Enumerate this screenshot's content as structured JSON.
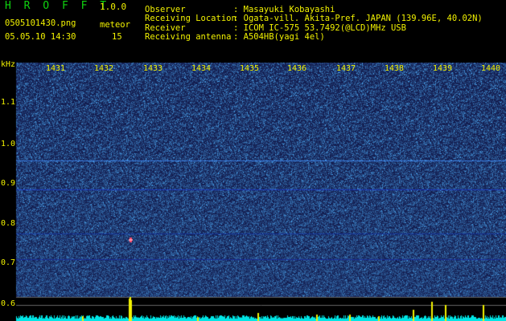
{
  "app": {
    "name": "H R O F F T",
    "version": "1.0.0"
  },
  "file": {
    "name": "0505101430.png",
    "datetime": "05.05.10 14:30"
  },
  "meteor": {
    "label": "meteor",
    "count": "15"
  },
  "info": [
    {
      "label": "Observer",
      "value": ": Masayuki Kobayashi"
    },
    {
      "label": "Receiving Location",
      "value": ": Ogata-vill. Akita-Pref. JAPAN (139.96E, 40.02N)"
    },
    {
      "label": "Receiver",
      "value": ": ICOM IC-575 53.7492(@LCD)MHz USB"
    },
    {
      "label": "Receiving antenna",
      "value": ": A504HB(yagi 4el)"
    }
  ],
  "axis": {
    "y_unit": "kHz",
    "y_ticks": [
      "1.1",
      "1.0",
      "0.9",
      "0.8",
      "0.7",
      "0.6"
    ],
    "x_ticks": [
      "1431",
      "1432",
      "1433",
      "1434",
      "1435",
      "1436",
      "1437",
      "1438",
      "1439",
      "1440"
    ]
  },
  "colors": {
    "text": "#f2f200",
    "logo": "#0fd30f",
    "background": "#000000",
    "spectrum": "#1a2a8c",
    "amplitude": "#00e5e5",
    "peak": "#f2f200"
  }
}
